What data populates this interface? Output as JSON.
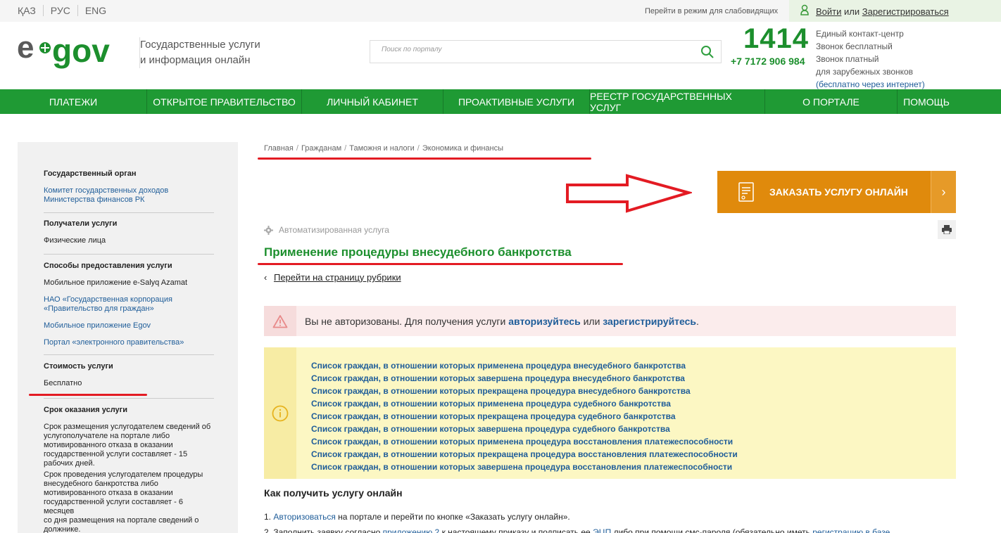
{
  "topbar": {
    "languages": [
      "ҚАЗ",
      "РУС",
      "ENG"
    ],
    "impaired_mode": "Перейти в режим для слабовидящих",
    "login": "Войти",
    "or": "или",
    "register": "Зарегистрироваться"
  },
  "header": {
    "logo_text": "e•gov",
    "slogan_line1": "Государственные услуги",
    "slogan_line2": "и информация онлайн",
    "search_placeholder": "Поиск по порталу",
    "phone_short": "1414",
    "phone_long": "+7 7172 906 984",
    "contact_lines": [
      "Единый контакт-центр",
      "Звонок бесплатный",
      "Звонок платный",
      "для зарубежных звонков"
    ],
    "contact_link": "(бесплатно через интернет)"
  },
  "nav": [
    "ПЛАТЕЖИ",
    "ОТКРЫТОЕ ПРАВИТЕЛЬСТВО",
    "ЛИЧНЫЙ КАБИНЕТ",
    "ПРОАКТИВНЫЕ УСЛУГИ",
    "РЕЕСТР ГОСУДАРСТВЕННЫХ УСЛУГ",
    "О ПОРТАЛЕ",
    "ПОМОЩЬ"
  ],
  "sidebar": {
    "agency_title": "Государственный орган",
    "agency_line1": "Комитет государственных доходов",
    "agency_line2": "Министерства финансов РК",
    "recipients_title": "Получатели услуги",
    "recipients": "Физические лица",
    "methods_title": "Способы предоставления услуги",
    "method1": "Мобильное приложение e-Salyq Azamat",
    "method2_line1": "НАО «Государственная корпорация",
    "method2_line2": "«Правительство для граждан»",
    "method3": "Мобильное приложение Egov",
    "method4": "Портал «электронного правительства»",
    "cost_title": "Стоимость услуги",
    "cost": "Бесплатно",
    "term_title": "Срок оказания услуги",
    "term1_lines": [
      "Срок размещения услугодателем сведений об",
      "услугополучателе на портале либо",
      "мотивированного отказа в оказании",
      "государственной услуги составляет - 15",
      "рабочих дней."
    ],
    "term2_lines": [
      "Срок проведения услугодателем процедуры",
      "внесудебного банкротства либо",
      "мотивированного отказа в оказании",
      "государственной услуги составляет - 6 месяцев",
      "со дня размещения на портале сведений о",
      "должнике."
    ]
  },
  "breadcrumb": [
    "Главная",
    "Гражданам",
    "Таможня и налоги",
    "Экономика и финансы"
  ],
  "order_button": "ЗАКАЗАТЬ УСЛУГУ ОНЛАЙН",
  "service_type": "Автоматизированная услуга",
  "service_title": "Применение процедуры внесудебного банкротства",
  "back_link": "Перейти на страницу рубрики",
  "warning": {
    "text1": "Вы не авторизованы. Для получения услуги",
    "link1": "авторизуйтесь",
    "text2": "или",
    "link2": "зарегистрируйтесь",
    "text3": "."
  },
  "info_links": [
    "Список граждан, в отношении которых применена процедура внесудебного банкротства",
    "Список граждан, в отношении которых завершена процедура внесудебного банкротства",
    "Список граждан, в отношении которых прекращена процедура внесудебного банкротства",
    "Список граждан, в отношении которых применена процедура судебного банкротства",
    "Список граждан, в отношении которых прекращена процедура судебного банкротства",
    "Список граждан, в отношении которых завершена процедура судебного банкротства",
    "Список граждан, в отношении которых применена процедура восстановления платежеспособности",
    "Список граждан, в отношении которых прекращена процедура восстановления платежеспособности",
    "Список граждан, в отношении которых завершена процедура восстановления платежеспособности"
  ],
  "how_title": "Как получить услугу онлайн",
  "step1": {
    "num": "1.",
    "link": "Авторизоваться",
    "text": "на портале и перейти по кнопке «Заказать услугу онлайн»."
  },
  "step2": {
    "num": "2.",
    "text1": "Заполнить заявку согласно",
    "link1": "приложению 2",
    "text2": "к настоящему приказу и подписать ее",
    "link2": "ЭЦП",
    "text3": "либо при помощи смс-пароля (обязательно иметь",
    "link3": "регистрацию в базе"
  },
  "colors": {
    "green": "#1f9a34",
    "title_green": "#1c8f2d",
    "orange": "#e08a0c",
    "link_blue": "#1f5d99",
    "annotation_red": "#e31b23"
  }
}
